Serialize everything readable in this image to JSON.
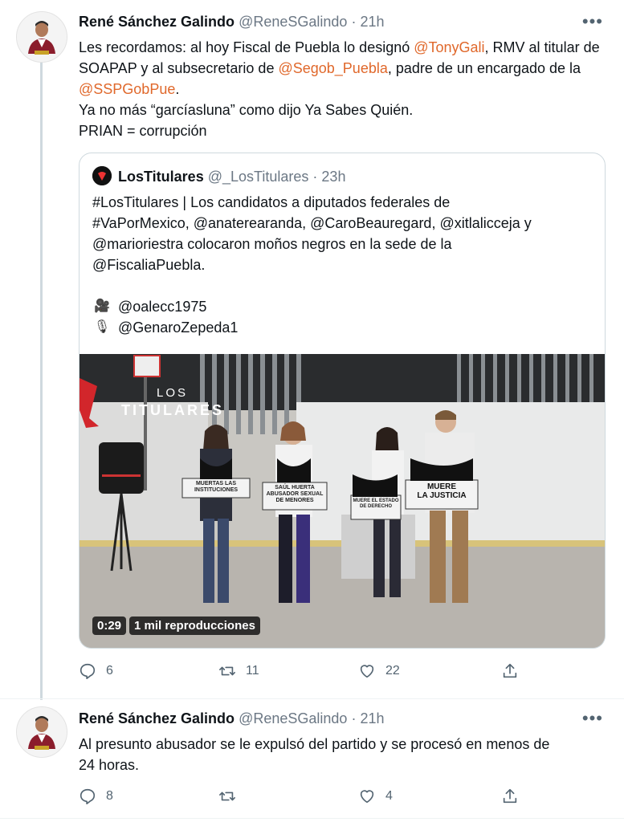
{
  "tweet1": {
    "author_name": "René Sánchez Galindo",
    "handle": "@ReneSGalindo",
    "separator": "·",
    "time": "21h",
    "more": "•••",
    "text": {
      "p1_a": "Les recordamos: al hoy Fiscal de Puebla lo designó ",
      "p1_m1": "@TonyGali",
      "p1_b": ", RMV al titular de SOAPAP y al subsecretario de ",
      "p1_m2": "@Segob_Puebla",
      "p1_c": ", padre de un encargado de la ",
      "p1_m3": "@SSPGobPue",
      "p1_d": ".",
      "line2": "Ya no más “garcíasluna” como dijo Ya Sabes Quién.",
      "line3": "PRIAN = corrupción"
    },
    "quote": {
      "author_name": "LosTitulares",
      "handle": "@_LosTitulares",
      "separator": "·",
      "time": "23h",
      "lines": [
        "#LosTitulares | Los candidatos a diputados federales de",
        "#VaPorMexico, @anaterearanda, @CaroBeauregard, @xitlalicceja y",
        "@marioriestra colocaron moños negros en la sede de la",
        "@FiscaliaPuebla."
      ],
      "credit1_icon": "🎥",
      "credit1": "@oalecc1975",
      "credit2_icon": "🎙",
      "credit2": "@GenaroZepeda1",
      "video": {
        "watermark": "LOS",
        "watermark2": "TITULARES",
        "sign1": "MUERTAS LAS INSTITUCIONES",
        "sign2": "SAÚL HUERTA ABUSADOR SEXUAL DE MENORES",
        "sign3": "MUERE EL ESTADO DE DERECHO",
        "sign4_a": "MUERE",
        "sign4_b": "LA JUSTICIA",
        "duration": "0:29",
        "views": "1 mil reproducciones"
      }
    },
    "actions": {
      "replies": "6",
      "retweets": "11",
      "likes": "22"
    }
  },
  "tweet2": {
    "author_name": "René Sánchez Galindo",
    "handle": "@ReneSGalindo",
    "separator": "·",
    "time": "21h",
    "more": "•••",
    "line1": "Al presunto abusador se le expulsó del partido y se procesó en menos de",
    "line2": "24 horas.",
    "actions": {
      "replies": "8",
      "retweets": "",
      "likes": "4"
    }
  },
  "colors": {
    "mention": "#e0682b",
    "text": "#0f1419",
    "muted": "#536471",
    "thread_line": "#cfd9de"
  },
  "icons": [
    "reply-icon",
    "retweet-icon",
    "like-icon",
    "share-icon",
    "more-icon",
    "camera-icon",
    "microphone-icon"
  ]
}
